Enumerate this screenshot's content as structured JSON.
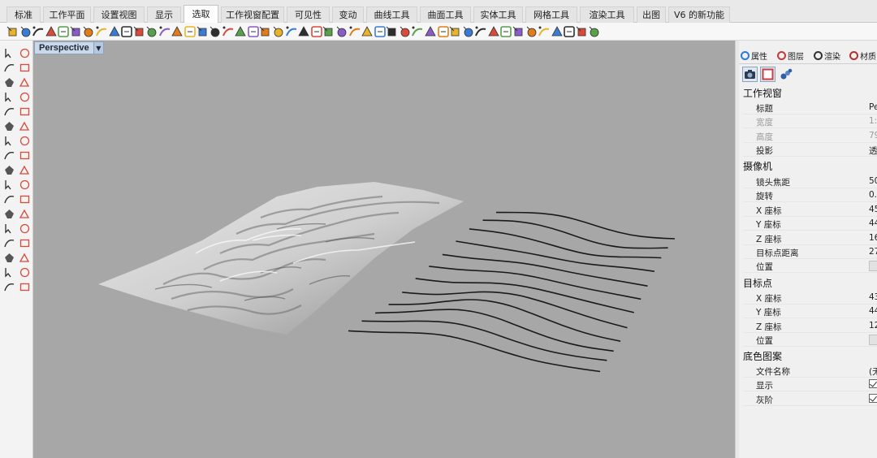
{
  "tabs": [
    {
      "label": "标准"
    },
    {
      "label": "工作平面"
    },
    {
      "label": "设置视图"
    },
    {
      "label": "显示"
    },
    {
      "label": "选取",
      "active": true
    },
    {
      "label": "工作视窗配置"
    },
    {
      "label": "可见性"
    },
    {
      "label": "变动"
    },
    {
      "label": "曲线工具"
    },
    {
      "label": "曲面工具"
    },
    {
      "label": "实体工具"
    },
    {
      "label": "网格工具"
    },
    {
      "label": "渲染工具"
    },
    {
      "label": "出图"
    },
    {
      "label": "V6 的新功能"
    }
  ],
  "toolbar_icons": [
    "select-points",
    "select-curves",
    "select-surfaces",
    "select-polysurfaces",
    "select-lines",
    "select-polylines",
    "select-arcs",
    "select-circles",
    "select-ellipses",
    "select-text",
    "select-dots",
    "select-lights",
    "select-meshes",
    "select-annotations",
    "select-blocks",
    "select-hatches",
    "select-subd",
    "select-cameras",
    "select-open",
    "select-closed",
    "select-planar",
    "select-by-color",
    "select-by-layer",
    "select-by-name",
    "select-duplicates",
    "select-small",
    "select-bad",
    "select-last",
    "select-previous",
    "select-all",
    "invert-selection",
    "select-visible",
    "select-hidden",
    "select-locked",
    "select-chain",
    "select-boundary",
    "select-intersect",
    "select-window",
    "select-crossing",
    "select-brush",
    "select-lasso",
    "select-filter",
    "select-history",
    "select-group",
    "select-children",
    "select-parents",
    "select-none"
  ],
  "left_tools": [
    "select",
    "point",
    "polyline",
    "curve",
    "circle",
    "arc",
    "polygon",
    "rectangle",
    "ellipse",
    "freeform",
    "extrude",
    "loft",
    "box",
    "sphere",
    "boolean",
    "fillet",
    "transform",
    "array",
    "split",
    "trim",
    "join",
    "explode",
    "offset",
    "project",
    "analyze",
    "mirror",
    "rotate",
    "scale",
    "group",
    "dimension",
    "text",
    "check",
    "render",
    "history"
  ],
  "viewport": {
    "title": "Perspective"
  },
  "panel": {
    "tabs": [
      {
        "label": "属性",
        "icon": "properties-icon",
        "color": "#2a7ad8"
      },
      {
        "label": "图层",
        "icon": "layers-icon",
        "color": "#c23a3a"
      },
      {
        "label": "渲染",
        "icon": "render-icon",
        "color": "#333333"
      },
      {
        "label": "材质",
        "icon": "material-icon",
        "color": "#b23030"
      }
    ],
    "sections": {
      "viewport": "工作视窗",
      "camera": "摄像机",
      "target": "目标点",
      "wallpaper": "底色图案"
    },
    "viewport_rows": [
      {
        "label": "标题",
        "value": "Pe"
      },
      {
        "label": "宽度",
        "value": "1:",
        "dim": true
      },
      {
        "label": "高度",
        "value": "79",
        "dim": true
      },
      {
        "label": "投影",
        "value": "透"
      }
    ],
    "camera_rows": [
      {
        "label": "镜头焦距",
        "value": "50"
      },
      {
        "label": "旋转",
        "value": "0."
      },
      {
        "label": "X 座标",
        "value": "45"
      },
      {
        "label": "Y 座标",
        "value": "44"
      },
      {
        "label": "Z 座标",
        "value": "16"
      },
      {
        "label": "目标点距离",
        "value": "27"
      },
      {
        "label": "位置",
        "value": null
      }
    ],
    "target_rows": [
      {
        "label": "X 座标",
        "value": "43"
      },
      {
        "label": "Y 座标",
        "value": "44"
      },
      {
        "label": "Z 座标",
        "value": "12"
      },
      {
        "label": "位置",
        "value": null
      }
    ],
    "wallpaper_rows": [
      {
        "label": "文件名称",
        "value": "(无"
      },
      {
        "label": "显示",
        "checked": true
      },
      {
        "label": "灰阶",
        "checked": true
      }
    ]
  }
}
